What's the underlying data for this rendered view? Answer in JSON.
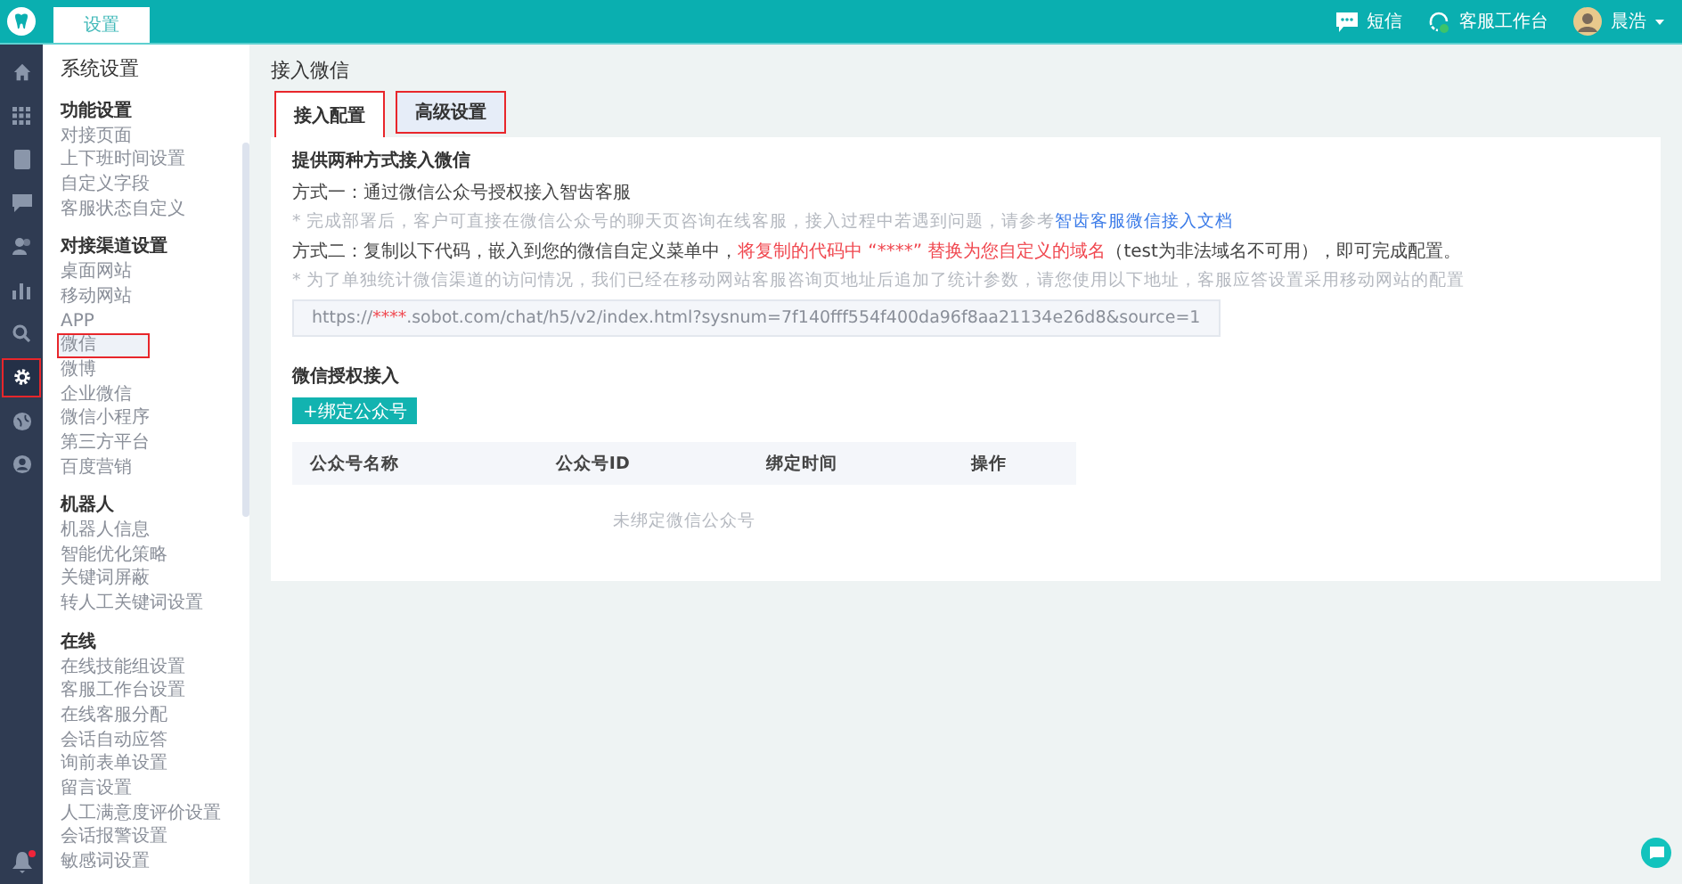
{
  "topbar": {
    "tabs": [
      {
        "label": "设置",
        "selected": true
      }
    ],
    "actions": [
      {
        "kind": "sms",
        "label": "短信"
      },
      {
        "kind": "workbench",
        "label": "客服工作台"
      },
      {
        "kind": "user",
        "label": "晨浩"
      }
    ]
  },
  "rail": {
    "items": [
      {
        "selected": false,
        "outlined": false
      },
      {
        "selected": false,
        "outlined": false
      },
      {
        "selected": false,
        "outlined": false
      },
      {
        "selected": false,
        "outlined": false
      },
      {
        "selected": false,
        "outlined": false
      },
      {
        "selected": false,
        "outlined": false
      },
      {
        "selected": false,
        "outlined": false
      },
      {
        "selected": true,
        "outlined": true
      },
      {
        "selected": false,
        "outlined": false
      },
      {
        "selected": false,
        "outlined": false
      }
    ],
    "notification": {
      "unread": true
    }
  },
  "sidebar": {
    "title": "系统设置",
    "groups": [
      {
        "title": "功能设置",
        "items": [
          {
            "label": "对接页面",
            "selected": false,
            "outlined": false
          },
          {
            "label": "上下班时间设置",
            "selected": false,
            "outlined": false
          },
          {
            "label": "自定义字段",
            "selected": false,
            "outlined": false
          },
          {
            "label": "客服状态自定义",
            "selected": false,
            "outlined": false
          }
        ]
      },
      {
        "title": "对接渠道设置",
        "items": [
          {
            "label": "桌面网站",
            "selected": false,
            "outlined": false
          },
          {
            "label": "移动网站",
            "selected": false,
            "outlined": false
          },
          {
            "label": "APP",
            "selected": false,
            "outlined": false
          },
          {
            "label": "微信",
            "selected": true,
            "outlined": true
          },
          {
            "label": "微博",
            "selected": false,
            "outlined": false
          },
          {
            "label": "企业微信",
            "selected": false,
            "outlined": false
          },
          {
            "label": "微信小程序",
            "selected": false,
            "outlined": false
          },
          {
            "label": "第三方平台",
            "selected": false,
            "outlined": false
          },
          {
            "label": "百度营销",
            "selected": false,
            "outlined": false
          }
        ]
      },
      {
        "title": "机器人",
        "items": [
          {
            "label": "机器人信息",
            "selected": false,
            "outlined": false
          },
          {
            "label": "智能优化策略",
            "selected": false,
            "outlined": false
          },
          {
            "label": "关键词屏蔽",
            "selected": false,
            "outlined": false
          },
          {
            "label": "转人工关键词设置",
            "selected": false,
            "outlined": false
          }
        ]
      },
      {
        "title": "在线",
        "items": [
          {
            "label": "在线技能组设置",
            "selected": false,
            "outlined": false
          },
          {
            "label": "客服工作台设置",
            "selected": false,
            "outlined": false
          },
          {
            "label": "在线客服分配",
            "selected": false,
            "outlined": false
          },
          {
            "label": "会话自动应答",
            "selected": false,
            "outlined": false
          },
          {
            "label": "询前表单设置",
            "selected": false,
            "outlined": false
          },
          {
            "label": "留言设置",
            "selected": false,
            "outlined": false
          },
          {
            "label": "人工满意度评价设置",
            "selected": false,
            "outlined": false
          },
          {
            "label": "会话报警设置",
            "selected": false,
            "outlined": false
          },
          {
            "label": "敏感词设置",
            "selected": false,
            "outlined": false
          }
        ]
      }
    ]
  },
  "main": {
    "title": "接入微信",
    "tabs": [
      {
        "label": "接入配置",
        "selected": true,
        "outlined": true
      },
      {
        "label": "高级设置",
        "selected": false,
        "outlined": true
      }
    ],
    "intro": "提供两种方式接入微信",
    "method_one": {
      "text": "方式一：通过微信公众号授权接入智齿客服",
      "note": "* 完成部署后，客户可直接在微信公众号的聊天页咨询在线客服，接入过程中若遇到问题，请参考",
      "link": "智齿客服微信接入文档"
    },
    "method_two": {
      "prefix": "方式二：复制以下代码，嵌入到您的微信自定义菜单中，",
      "highlight": "将复制的代码中 “****” 替换为您自定义的域名",
      "suffix": "（test为非法域名不可用），即可完成配置。",
      "note": "* 为了单独统计微信渠道的访问情况，我们已经在移动网站客服咨询页地址后追加了统计参数，请您使用以下地址，客服应答设置采用移动网站的配置"
    },
    "url": {
      "scheme": "https://",
      "mask": "****",
      "rest": ".sobot.com/chat/h5/v2/index.html?sysnum=7f140fff554f400da96f8aa21134e26d8&source=1"
    },
    "auth_title": "微信授权接入",
    "bind_button": "+绑定公众号",
    "table": {
      "columns": [
        "公众号名称",
        "公众号ID",
        "绑定时间",
        "操作"
      ],
      "empty": "未绑定微信公众号"
    }
  }
}
